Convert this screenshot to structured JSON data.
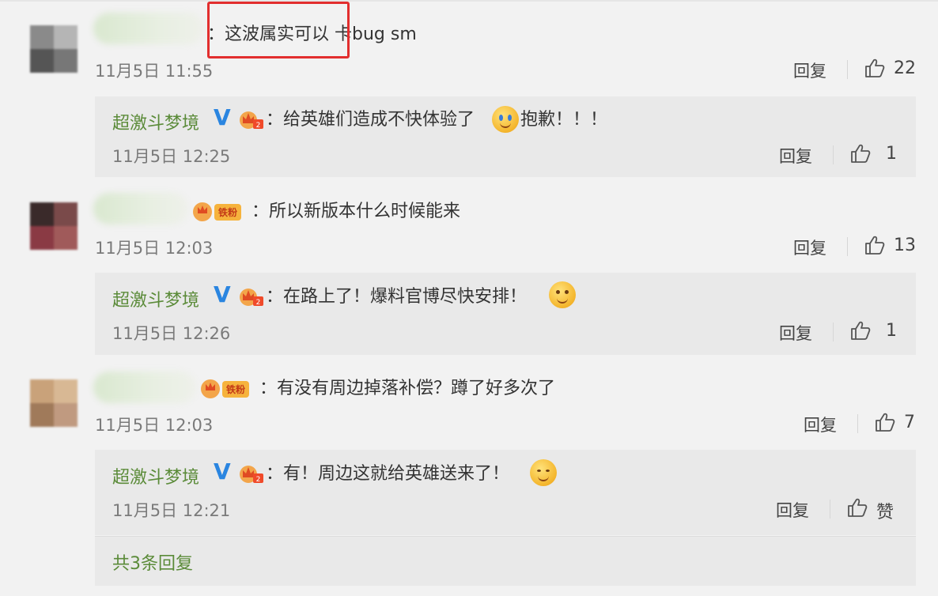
{
  "highlight_color": "#e22e2e",
  "accent_green": "#5b8b39",
  "verified_color": "#2a85e0",
  "comments": [
    {
      "text": "：这波属实可以 卡bug sm",
      "time": "11月5日 11:55",
      "reply_label": "回复",
      "likes": "22",
      "reply": {
        "name": "超激斗梦境",
        "verified": "V",
        "text": "：给英雄们造成不快体验了",
        "text_after": "抱歉！！！",
        "time": "11月5日 12:25",
        "reply_label": "回复",
        "likes": "1"
      }
    },
    {
      "text": "：所以新版本什么时候能来",
      "badge_tag": "铁粉",
      "time": "11月5日 12:03",
      "reply_label": "回复",
      "likes": "13",
      "reply": {
        "name": "超激斗梦境",
        "verified": "V",
        "text": "：在路上了！爆料官博尽快安排！",
        "time": "11月5日 12:26",
        "reply_label": "回复",
        "likes": "1"
      }
    },
    {
      "text": "：有没有周边掉落补偿？蹲了好多次了",
      "badge_tag": "铁粉",
      "time": "11月5日 12:03",
      "reply_label": "回复",
      "likes": "7",
      "reply": {
        "name": "超激斗梦境",
        "verified": "V",
        "text": "：有！周边这就给英雄送来了！",
        "time": "11月5日 12:21",
        "reply_label": "回复",
        "likes": "赞"
      }
    }
  ],
  "more_replies": "共3条回复"
}
